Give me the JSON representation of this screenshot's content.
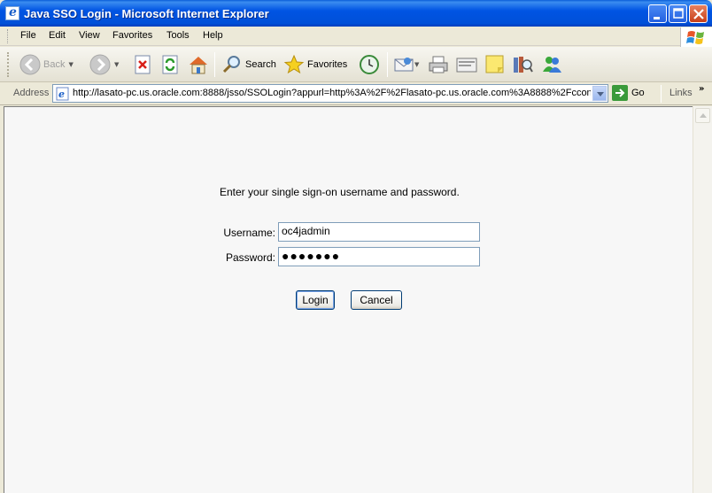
{
  "window": {
    "title": "Java SSO Login - Microsoft Internet Explorer"
  },
  "menu": {
    "items": [
      {
        "label": "File"
      },
      {
        "label": "Edit"
      },
      {
        "label": "View"
      },
      {
        "label": "Favorites"
      },
      {
        "label": "Tools"
      },
      {
        "label": "Help"
      }
    ]
  },
  "toolbar": {
    "back_label": "Back",
    "search_label": "Search",
    "favorites_label": "Favorites"
  },
  "address": {
    "label": "Address",
    "url": "http://lasato-pc.us.oracle.com:8888/jsso/SSOLogin?appurl=http%3A%2F%2Flasato-pc.us.oracle.com%3A8888%2Fccon",
    "go_label": "Go",
    "links_label": "Links"
  },
  "login": {
    "prompt": "Enter your single sign-on username and password.",
    "username_label": "Username:",
    "username_value": "oc4jadmin",
    "password_label": "Password:",
    "password_value": "●●●●●●●",
    "login_button": "Login",
    "cancel_button": "Cancel"
  }
}
